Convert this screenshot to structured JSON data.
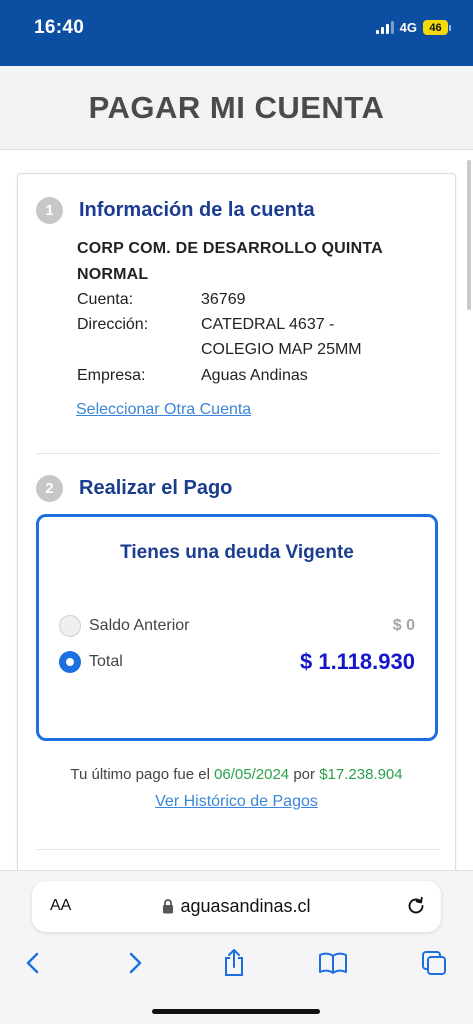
{
  "status_bar": {
    "time": "16:40",
    "network": "4G",
    "battery": "46"
  },
  "page": {
    "title": "PAGAR MI CUENTA"
  },
  "account_section": {
    "step_number": "1",
    "title": "Información de la cuenta",
    "company_name": "CORP COM. DE DESARROLLO QUINTA NORMAL",
    "fields": [
      {
        "label": "Cuenta:",
        "value": "36769"
      },
      {
        "label": "Dirección:",
        "value": "CATEDRAL 4637 - COLEGIO MAP 25MM"
      },
      {
        "label": "Empresa:",
        "value": "Aguas Andinas"
      }
    ],
    "select_other_link": "Seleccionar Otra Cuenta"
  },
  "payment_section": {
    "step_number": "2",
    "title": "Realizar el Pago",
    "debt_title": "Tienes una deuda Vigente",
    "options": [
      {
        "label": "Saldo Anterior",
        "amount": "$ 0",
        "selected": false
      },
      {
        "label": "Total",
        "amount": "$ 1.118.930",
        "selected": true
      }
    ],
    "last_payment": {
      "prefix": "Tu último pago fue el",
      "date": "06/05/2024",
      "connector": "por",
      "amount": "$17.238.904"
    },
    "history_link": "Ver Histórico de Pagos"
  },
  "browser": {
    "text_size_label": "AA",
    "url": "aguasandinas.cl"
  },
  "colors": {
    "header_blue": "#0c4ea2",
    "title_navy": "#1a3d8f",
    "accent_blue": "#1b6fe0",
    "total_blue": "#1515c9",
    "payment_green": "#2ba14a",
    "link_blue": "#3b86d9"
  },
  "icons": [
    "signal-icon",
    "battery-icon",
    "lock-icon",
    "reload-icon",
    "back-icon",
    "forward-icon",
    "share-icon",
    "bookmarks-icon",
    "tabs-icon"
  ]
}
